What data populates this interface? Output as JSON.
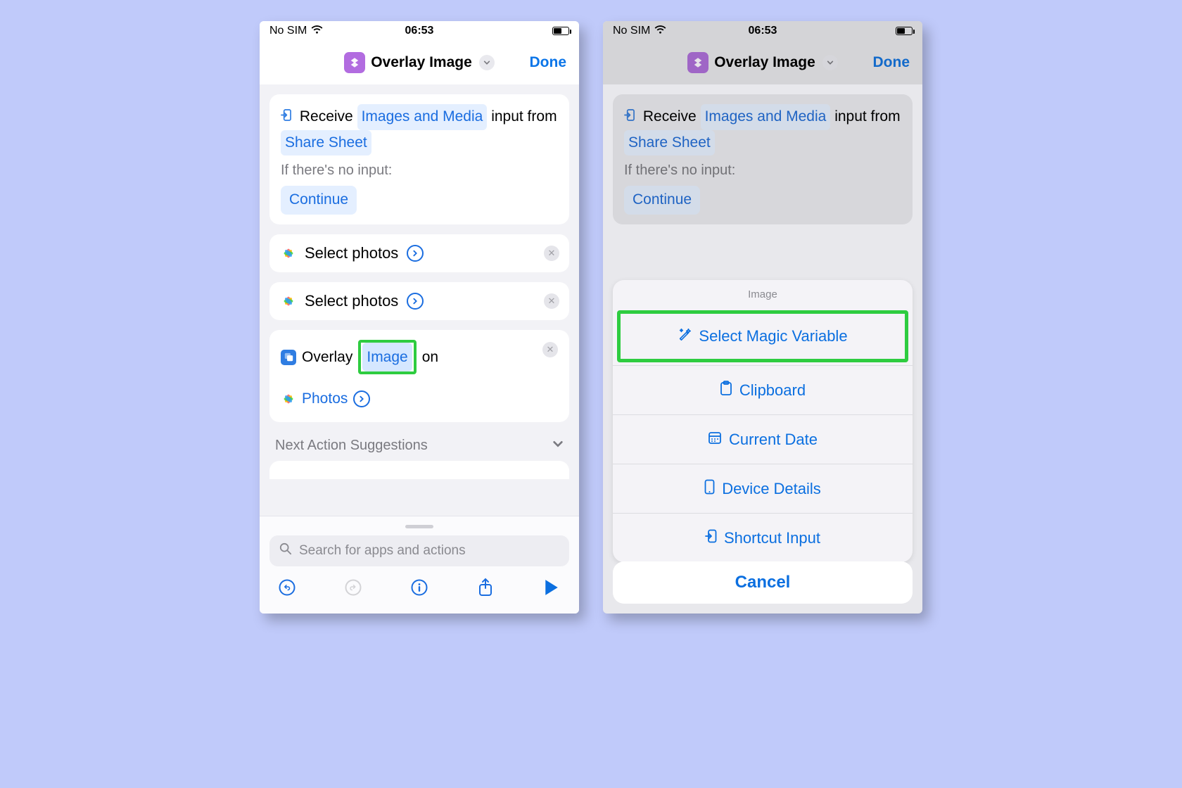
{
  "status": {
    "carrier": "No SIM",
    "time": "06:53"
  },
  "nav": {
    "title": "Overlay Image",
    "done": "Done"
  },
  "receive": {
    "receive": "Receive",
    "input_type": "Images and Media",
    "from_label": "input from",
    "source": "Share Sheet",
    "noinput": "If there's no input:",
    "fallback": "Continue"
  },
  "select": {
    "label": "Select photos"
  },
  "overlay": {
    "verb": "Overlay",
    "image_token": "Image",
    "on": "on",
    "target": "Photos"
  },
  "suggest": "Next Action Suggestions",
  "search_placeholder": "Search for apps and actions",
  "sheet": {
    "title": "Image",
    "magic": "Select Magic Variable",
    "clipboard": "Clipboard",
    "date": "Current Date",
    "device": "Device Details",
    "input": "Shortcut Input",
    "cancel": "Cancel"
  }
}
